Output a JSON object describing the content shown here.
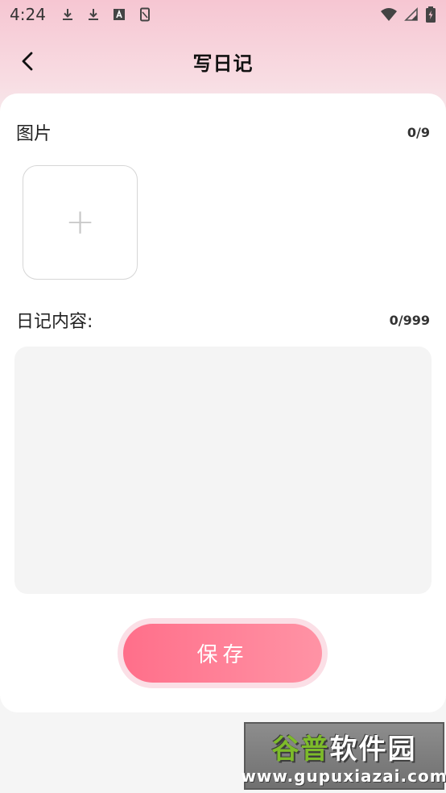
{
  "status_bar": {
    "time": "4:24",
    "left_icons": [
      "download-icon",
      "download-icon",
      "a-box-icon",
      "sim-card-icon"
    ],
    "right_icons": [
      "wifi-icon",
      "signal-icon",
      "battery-charging-icon"
    ]
  },
  "nav": {
    "title": "写日记",
    "back_icon": "chevron-left-icon"
  },
  "photos": {
    "label": "图片",
    "count": "0/9",
    "add_icon": "+"
  },
  "content": {
    "label": "日记内容:",
    "count": "0/999",
    "value": "",
    "placeholder": ""
  },
  "save": {
    "label": "保存"
  },
  "watermark": {
    "logo_text_part1": "谷普",
    "logo_text_part2": "软件园",
    "url": "www.gupuxiazai.com"
  },
  "colors": {
    "accent": "#ff7a92",
    "header_pink": "#f6c6d2",
    "card_bg": "#ffffff",
    "input_bg": "#f4f4f4"
  }
}
